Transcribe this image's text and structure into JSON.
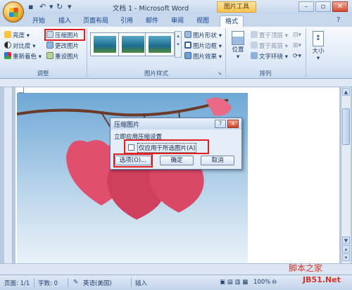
{
  "titlebar": {
    "document_title": "文档 1 - Microsoft Word",
    "context_tab_title": "图片工具",
    "quick_access": [
      "save-icon",
      "undo-icon",
      "redo-icon",
      "customize-icon"
    ]
  },
  "tabs": [
    "开始",
    "插入",
    "页面布局",
    "引用",
    "邮件",
    "审阅",
    "视图",
    "格式"
  ],
  "active_tab": "格式",
  "ribbon": {
    "adjust": {
      "label": "调整",
      "brightness": "亮度",
      "contrast": "对比度",
      "recolor": "重新着色",
      "compress": "压缩图片",
      "change_picture": "更改图片",
      "reset_picture": "重设图片"
    },
    "picture_styles": {
      "label": "图片样式",
      "shape": "图片形状",
      "border": "图片边框",
      "effects": "图片效果"
    },
    "arrange": {
      "label": "排列",
      "position": "位置",
      "bring_front": "置于顶层",
      "send_back": "置于底层",
      "text_wrap": "文字环绕"
    },
    "size": {
      "label": "大小"
    }
  },
  "dialog": {
    "title": "压缩图片",
    "help_button": "?",
    "close_button": "×",
    "section_title": "立即应用压缩设置",
    "checkbox_label": "仅应用于所选图片(A)",
    "checkbox_checked": false,
    "options_button": "选项(O)...",
    "ok_button": "确定",
    "cancel_button": "取消"
  },
  "statusbar": {
    "page": "页面: 1/1",
    "words": "字数: 0",
    "language": "英语(美国)",
    "insert_mode": "插入",
    "zoom": "100%"
  },
  "watermark": {
    "line1": "脚本之家",
    "line2": "JB51.Net"
  },
  "colors": {
    "highlight_red": "#e02020",
    "ribbon_text": "#15428b",
    "context_tab": "#f5c24f"
  }
}
